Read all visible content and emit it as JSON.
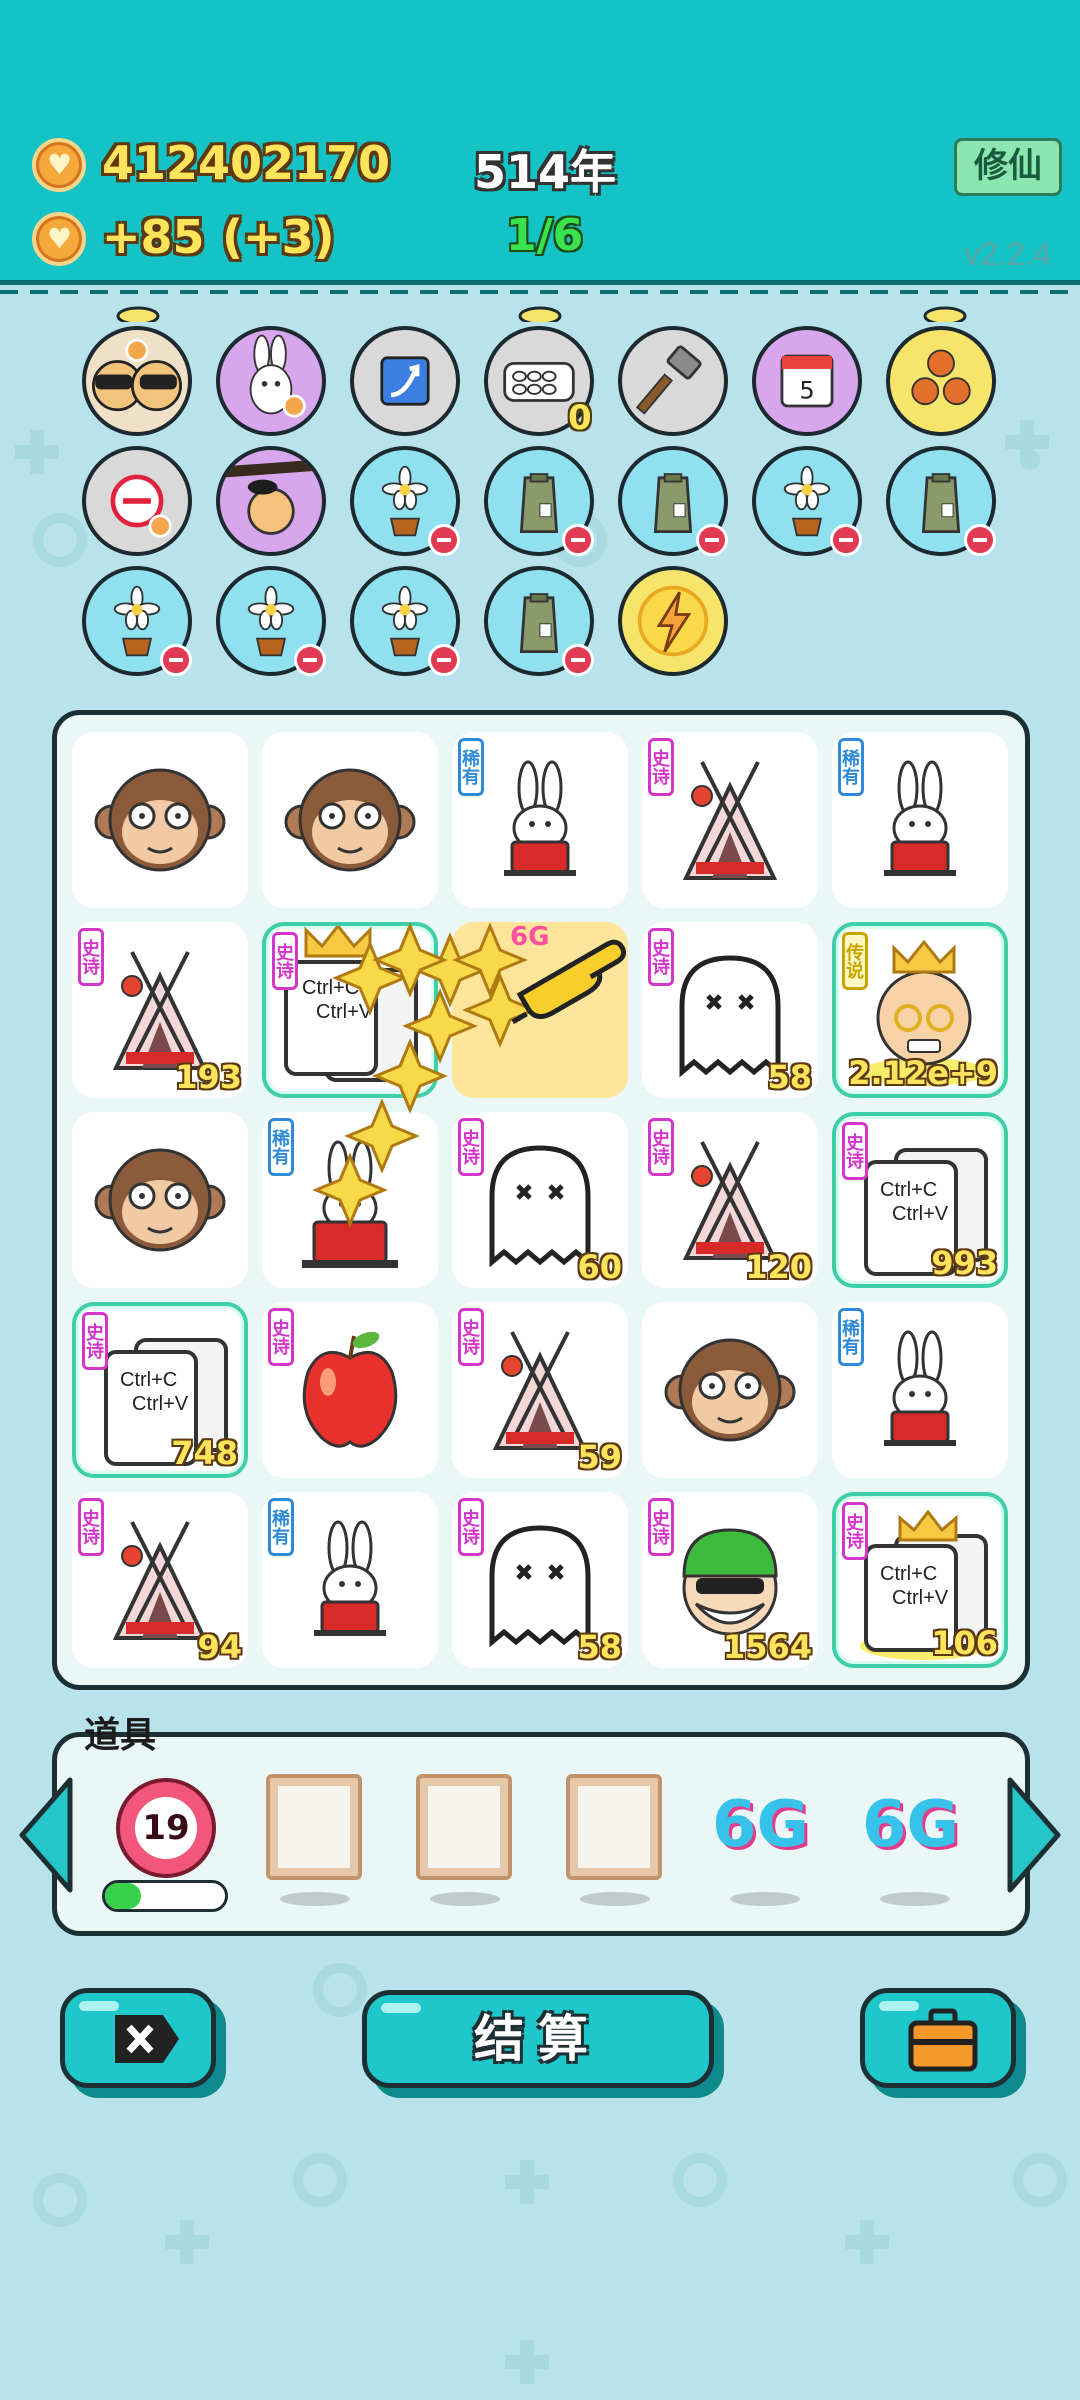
{
  "header": {
    "coins": "412402170",
    "income": "+85",
    "income_bonus": "(+3)",
    "year": "514年",
    "progress": "1/6",
    "xiuxian_label": "修仙",
    "version": "v2.2.4"
  },
  "relics": [
    {
      "name": "sunglasses-cats",
      "row": 1
    },
    {
      "name": "rabbit",
      "row": 1
    },
    {
      "name": "arrow-card",
      "row": 1
    },
    {
      "name": "egg-tray",
      "row": 1,
      "count": "0"
    },
    {
      "name": "hammer",
      "row": 1
    },
    {
      "name": "calendar",
      "row": 1,
      "day": "5"
    },
    {
      "name": "basketballs",
      "row": 1
    },
    {
      "name": "no-entry",
      "row": 2
    },
    {
      "name": "peach-branch",
      "row": 2
    },
    {
      "name": "flower-pot",
      "row": 2
    },
    {
      "name": "money-bag",
      "row": 2
    },
    {
      "name": "money-bag",
      "row": 2
    },
    {
      "name": "flower-pot",
      "row": 2
    },
    {
      "name": "money-bag",
      "row": 2
    },
    {
      "name": "flower-pot",
      "row": 3
    },
    {
      "name": "flower-pot",
      "row": 3
    },
    {
      "name": "flower-pot",
      "row": 3
    },
    {
      "name": "money-bag",
      "row": 3
    },
    {
      "name": "lightning",
      "row": 3
    }
  ],
  "board": {
    "cells": [
      {
        "type": "monkey",
        "rarity": "",
        "value": ""
      },
      {
        "type": "monkey",
        "rarity": "",
        "value": ""
      },
      {
        "type": "rabbit",
        "rarity": "稀有",
        "value": ""
      },
      {
        "type": "tent",
        "rarity": "史诗",
        "value": ""
      },
      {
        "type": "rabbit",
        "rarity": "稀有",
        "value": ""
      },
      {
        "type": "tent",
        "rarity": "史诗",
        "value": "193"
      },
      {
        "type": "copy-paste-crowned",
        "rarity": "史诗",
        "value": ""
      },
      {
        "type": "active",
        "rarity": "",
        "value": "",
        "tag": "6G"
      },
      {
        "type": "ghost",
        "rarity": "史诗",
        "value": "58"
      },
      {
        "type": "king",
        "rarity": "传说",
        "value": "2.12e+9"
      },
      {
        "type": "monkey",
        "rarity": "",
        "value": ""
      },
      {
        "type": "rabbit",
        "rarity": "稀有",
        "value": ""
      },
      {
        "type": "ghost",
        "rarity": "史诗",
        "value": "60"
      },
      {
        "type": "tent",
        "rarity": "史诗",
        "value": "120"
      },
      {
        "type": "copy-paste",
        "rarity": "史诗",
        "value": "993"
      },
      {
        "type": "copy-paste",
        "rarity": "史诗",
        "value": "748"
      },
      {
        "type": "apple",
        "rarity": "史诗",
        "value": ""
      },
      {
        "type": "tent",
        "rarity": "史诗",
        "value": "59"
      },
      {
        "type": "monkey",
        "rarity": "",
        "value": ""
      },
      {
        "type": "rabbit",
        "rarity": "稀有",
        "value": ""
      },
      {
        "type": "tent",
        "rarity": "史诗",
        "value": "94"
      },
      {
        "type": "rabbit",
        "rarity": "稀有",
        "value": ""
      },
      {
        "type": "ghost",
        "rarity": "史诗",
        "value": "58"
      },
      {
        "type": "bandit",
        "rarity": "史诗",
        "value": "1564"
      },
      {
        "type": "copy-paste-crowned",
        "rarity": "史诗",
        "value": "106"
      }
    ],
    "copy_text": "Ctrl+C",
    "paste_text": "Ctrl+V"
  },
  "items": {
    "title": "道具",
    "counter": "19",
    "counter_fill": 0.3,
    "slots": [
      "frame",
      "frame",
      "frame",
      "6G",
      "6G"
    ],
    "six_g_label": "6G"
  },
  "buttons": {
    "settle_label": "结算",
    "skip_icon": "close-x-icon",
    "bag_icon": "briefcase-icon"
  },
  "colors": {
    "header": "#13c3c5",
    "background": "#b9e3ea",
    "button": "#1ec7c9",
    "coin_text": "#ffe35a",
    "epic": "#d336c8",
    "rare": "#2f8ad8",
    "legend": "#c9a400"
  }
}
